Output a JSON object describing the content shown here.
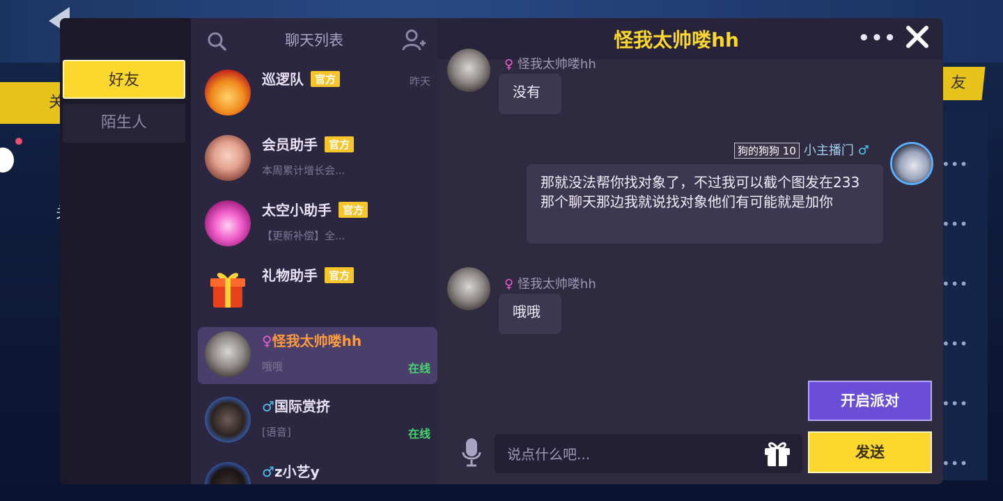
{
  "background": {
    "left_button_text": "关",
    "right_button_text": "友",
    "left_side_text": "关"
  },
  "categories": [
    {
      "label": "好友",
      "active": true
    },
    {
      "label": "陌生人",
      "active": false
    }
  ],
  "chat_list": {
    "title": "聊天列表",
    "contacts": [
      {
        "name": "巡逻队",
        "badge": "官方",
        "sub": "",
        "time": "昨天",
        "online": ""
      },
      {
        "name": "会员助手",
        "badge": "官方",
        "sub": "本周累计增长会...",
        "time": "",
        "online": ""
      },
      {
        "name": "太空小助手",
        "badge": "官方",
        "sub": "【更新补偿】全...",
        "time": "",
        "online": ""
      },
      {
        "name": "礼物助手",
        "badge": "官方",
        "sub": "",
        "time": "",
        "online": ""
      },
      {
        "name": "怪我太帅喽hh",
        "gender": "♀",
        "sub": "哦哦",
        "time": "",
        "online": "在线",
        "selected": true
      },
      {
        "name": "国际赏挤",
        "gender": "♂",
        "sub": "[语音]",
        "time": "",
        "online": "在线"
      },
      {
        "name": "z小艺y",
        "gender": "♂",
        "sub": "",
        "time": "",
        "online": ""
      }
    ]
  },
  "chat": {
    "title": "怪我太帅喽hh",
    "more_icon": "more-horizontal-icon",
    "messages": [
      {
        "side": "left",
        "name": "怪我太帅喽hh",
        "gender": "♀",
        "text": "没有"
      },
      {
        "side": "right",
        "name": "小主播门",
        "gender": "♂",
        "tag": "狗的狗狗",
        "level": "10",
        "text": "那就没法帮你找对象了，不过我可以截个图发在233那个聊天那边我就说找对象他们有可能就是加你"
      },
      {
        "side": "left",
        "name": "怪我太帅喽hh",
        "gender": "♀",
        "text": "哦哦"
      }
    ],
    "input_placeholder": "说点什么吧...",
    "party_button": "开启派对",
    "send_button": "发送"
  },
  "colors": {
    "accent_yellow": "#fcd72d",
    "title_yellow": "#fcd72d",
    "purple_button": "#6a4ed8",
    "online_green": "#46d46e",
    "female_pink": "#e85fd0",
    "male_blue": "#4cc4f4"
  }
}
